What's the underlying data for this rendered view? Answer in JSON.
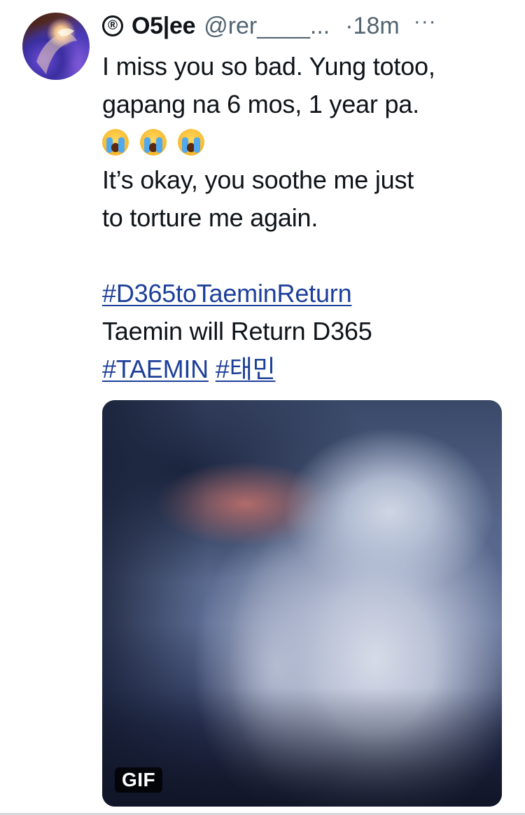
{
  "author": {
    "reg_mark": "®",
    "display_name": "O5|ee",
    "handle": "@rer____...",
    "time": "·18m",
    "more": "···"
  },
  "tweet": {
    "line1": "I miss you so bad. Yung totoo,",
    "line2": "gapang na 6 mos, 1 year pa.",
    "emoji_name": "loudly-crying-face-icon",
    "emoji_count": 3,
    "line3": "It’s okay, you soothe me just",
    "line4": "to torture me again.",
    "hashtag1": "#D365toTaeminReturn",
    "line5": "Taemin will Return D365",
    "hashtag2": "#TAEMIN",
    "hashtag3": "#태민"
  },
  "media": {
    "badge": "GIF"
  },
  "colors": {
    "text": "#0f1419",
    "muted": "#536471",
    "link": "#1d3f9a"
  }
}
